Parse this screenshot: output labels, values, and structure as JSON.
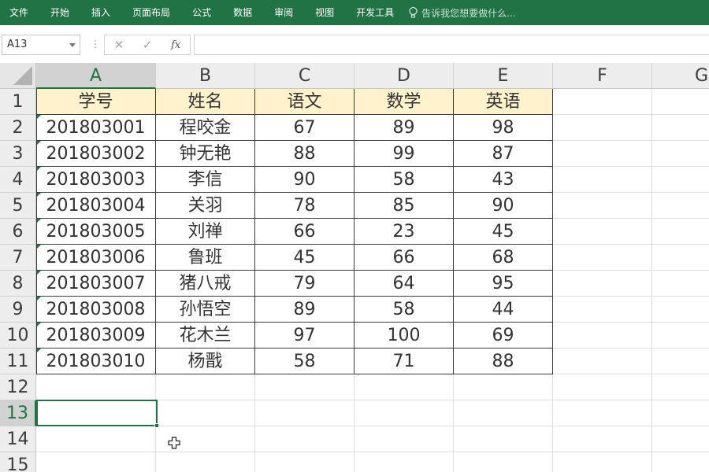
{
  "ribbon": {
    "tabs": [
      "文件",
      "开始",
      "插入",
      "页面布局",
      "公式",
      "数据",
      "审阅",
      "视图",
      "开发工具"
    ],
    "tell_me": "告诉我您想要做什么...",
    "tell_me_icon": "lightbulb-icon"
  },
  "formula_bar": {
    "name_box": "A13",
    "separator": "⋮",
    "cancel_glyph": "✕",
    "enter_glyph": "✓",
    "fx_label": "fx",
    "content": ""
  },
  "sheet": {
    "columns": [
      "A",
      "B",
      "C",
      "D",
      "E",
      "F",
      "G"
    ],
    "selected_column": "A",
    "rows": [
      "1",
      "2",
      "3",
      "4",
      "5",
      "6",
      "7",
      "8",
      "9",
      "10",
      "11",
      "12",
      "13",
      "14",
      "15"
    ],
    "selected_row": "13",
    "header_fill": "#fff2cc",
    "accent": "#217346",
    "table_header": [
      "学号",
      "姓名",
      "语文",
      "数学",
      "英语"
    ],
    "table_rows": [
      [
        "201803001",
        "程咬金",
        "67",
        "89",
        "98"
      ],
      [
        "201803002",
        "钟无艳",
        "88",
        "99",
        "87"
      ],
      [
        "201803003",
        "李信",
        "90",
        "58",
        "43"
      ],
      [
        "201803004",
        "关羽",
        "78",
        "85",
        "90"
      ],
      [
        "201803005",
        "刘禅",
        "66",
        "23",
        "45"
      ],
      [
        "201803006",
        "鲁班",
        "45",
        "66",
        "68"
      ],
      [
        "201803007",
        "猪八戒",
        "79",
        "64",
        "95"
      ],
      [
        "201803008",
        "孙悟空",
        "89",
        "58",
        "44"
      ],
      [
        "201803009",
        "花木兰",
        "97",
        "100",
        "69"
      ],
      [
        "201803010",
        "杨戬",
        "58",
        "71",
        "88"
      ]
    ],
    "active_cell": "A13"
  }
}
